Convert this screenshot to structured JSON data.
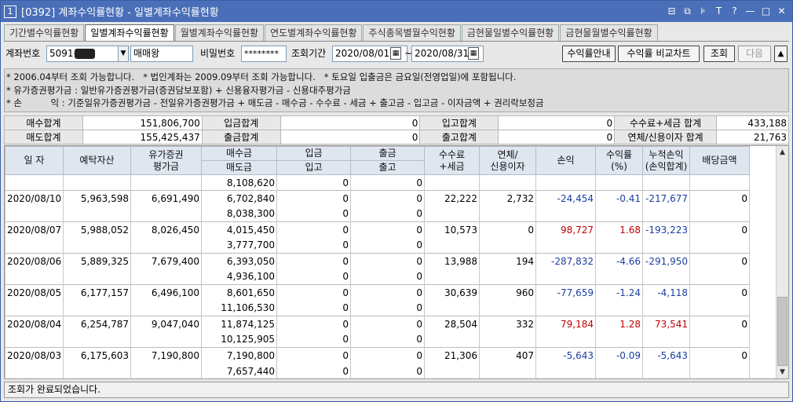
{
  "window": {
    "icon_label": "1",
    "title": "[0392] 계좌수익률현황 - 일별계좌수익률현황",
    "controls": [
      "⊟",
      "⧉",
      "⊧",
      "T",
      "?",
      "—",
      "□",
      "✕"
    ]
  },
  "tabs": [
    {
      "label": "기간별수익률현황",
      "active": false
    },
    {
      "label": "일별계좌수익률현황",
      "active": true
    },
    {
      "label": "월별계좌수익률현황",
      "active": false
    },
    {
      "label": "연도별계좌수익률현황",
      "active": false
    },
    {
      "label": "주식종목별월수익현황",
      "active": false
    },
    {
      "label": "금현물일별수익률현황",
      "active": false
    },
    {
      "label": "금현물월별수익률현황",
      "active": false
    }
  ],
  "query": {
    "account_label": "계좌번호",
    "account_value": "5091-",
    "account_name": "매매왕",
    "password_label": "비밀번호",
    "password_value": "********",
    "period_label": "조회기간",
    "date_from": "2020/08/01",
    "tilde": "~",
    "date_to": "2020/08/31",
    "btn_guide": "수익률안내",
    "btn_compare": "수익률 비교차트",
    "btn_search": "조회",
    "btn_next": "다음",
    "btn_up": "▲"
  },
  "notes": [
    "* 2006.04부터 조회 가능합니다.   * 법인계좌는 2009.09부터 조회 가능합니다.   * 토요일 입출금은 금요일(전영업일)에 포함됩니다.",
    "* 유가증권평가금 : 일반유가증권평가금(증권담보포함) + 신용융자평가금 - 신용대주평가금",
    "* 손          익 : 기준일유가증권평가금 - 전일유가증권평가금 + 매도금 - 매수금 - 수수료 - 세금 + 출고금 - 입고금 - 이자금액 + 권리락보정금"
  ],
  "summary": {
    "rows": [
      [
        {
          "label": "매수합계",
          "value": "151,806,700"
        },
        {
          "label": "입금합계",
          "value": "0"
        },
        {
          "label": "입고합계",
          "value": "0"
        },
        {
          "label": "수수료+세금 합계",
          "value": "433,188"
        }
      ],
      [
        {
          "label": "매도합계",
          "value": "155,425,437"
        },
        {
          "label": "출금합계",
          "value": "0"
        },
        {
          "label": "출고합계",
          "value": "0"
        },
        {
          "label": "연체/신용이자 합계",
          "value": "21,763"
        }
      ]
    ]
  },
  "grid": {
    "headers": {
      "date": "일 자",
      "deposit": "예탁자산",
      "securities": "유가증권\n평가금",
      "buy": "매수금",
      "sell": "매도금",
      "in_cash": "입금",
      "in_stock": "입고",
      "out_cash": "출금",
      "out_stock": "출고",
      "fee": "수수료\n+세금",
      "interest": "연체/\n신용이자",
      "pnl": "손익",
      "rate": "수익률\n(%)",
      "cum": "누적손익\n(손익합계)",
      "dividend": "배당금액"
    },
    "partial_row": {
      "sell": "8,108,620",
      "in_stock": "0",
      "out_stock": "0"
    },
    "rows": [
      {
        "date": "2020/08/10",
        "deposit": "5,963,598",
        "securities": "6,691,490",
        "buy": "6,702,840",
        "sell": "8,038,300",
        "in_cash": "0",
        "in_stock": "0",
        "out_cash": "0",
        "out_stock": "0",
        "fee": "22,222",
        "interest": "2,732",
        "pnl": "-24,454",
        "rate": "-0.41",
        "cum": "-217,677",
        "dividend": "0"
      },
      {
        "date": "2020/08/07",
        "deposit": "5,988,052",
        "securities": "8,026,450",
        "buy": "4,015,450",
        "sell": "3,777,700",
        "in_cash": "0",
        "in_stock": "0",
        "out_cash": "0",
        "out_stock": "0",
        "fee": "10,573",
        "interest": "0",
        "pnl": "98,727",
        "rate": "1.68",
        "cum": "-193,223",
        "dividend": "0"
      },
      {
        "date": "2020/08/06",
        "deposit": "5,889,325",
        "securities": "7,679,400",
        "buy": "6,393,050",
        "sell": "4,936,100",
        "in_cash": "0",
        "in_stock": "0",
        "out_cash": "0",
        "out_stock": "0",
        "fee": "13,988",
        "interest": "194",
        "pnl": "-287,832",
        "rate": "-4.66",
        "cum": "-291,950",
        "dividend": "0"
      },
      {
        "date": "2020/08/05",
        "deposit": "6,177,157",
        "securities": "6,496,100",
        "buy": "8,601,650",
        "sell": "11,106,530",
        "in_cash": "0",
        "in_stock": "0",
        "out_cash": "0",
        "out_stock": "0",
        "fee": "30,639",
        "interest": "960",
        "pnl": "-77,659",
        "rate": "-1.24",
        "cum": "-4,118",
        "dividend": "0"
      },
      {
        "date": "2020/08/04",
        "deposit": "6,254,787",
        "securities": "9,047,040",
        "buy": "11,874,125",
        "sell": "10,125,905",
        "in_cash": "0",
        "in_stock": "0",
        "out_cash": "0",
        "out_stock": "0",
        "fee": "28,504",
        "interest": "332",
        "pnl": "79,184",
        "rate": "1.28",
        "cum": "73,541",
        "dividend": "0"
      },
      {
        "date": "2020/08/03",
        "deposit": "6,175,603",
        "securities": "7,190,800",
        "buy": "7,190,800",
        "sell": "7,657,440",
        "in_cash": "0",
        "in_stock": "0",
        "out_cash": "0",
        "out_stock": "0",
        "fee": "21,306",
        "interest": "407",
        "pnl": "-5,643",
        "rate": "-0.09",
        "cum": "-5,643",
        "dividend": "0"
      }
    ]
  },
  "scroll": {
    "up": "▲",
    "down": "▼"
  },
  "status": "조회가 완료되었습니다.",
  "colors": {
    "title_bar": "#4a6fb8",
    "negative": "#1c3fa0",
    "positive": "#c00000",
    "header_bg": "#dfe6f0"
  }
}
